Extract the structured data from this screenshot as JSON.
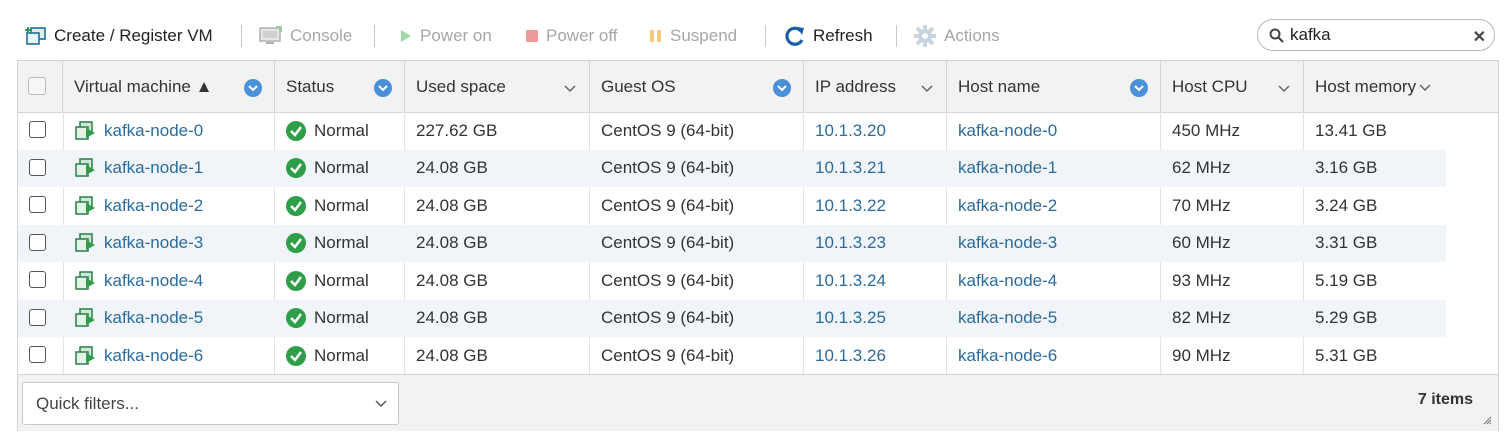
{
  "toolbar": {
    "create_label": "Create / Register VM",
    "console_label": "Console",
    "poweron_label": "Power on",
    "poweroff_label": "Power off",
    "suspend_label": "Suspend",
    "refresh_label": "Refresh",
    "actions_label": "Actions"
  },
  "search": {
    "value": "kafka"
  },
  "columns": {
    "vm": "Virtual machine ▲",
    "status": "Status",
    "used": "Used space",
    "os": "Guest OS",
    "ip": "IP address",
    "host": "Host name",
    "cpu": "Host CPU",
    "mem": "Host memory"
  },
  "rows": [
    {
      "name": "kafka-node-0",
      "status": "Normal",
      "used": "227.62 GB",
      "os": "CentOS 9 (64-bit)",
      "ip": "10.1.3.20",
      "host": "kafka-node-0",
      "cpu": "450 MHz",
      "mem": "13.41 GB"
    },
    {
      "name": "kafka-node-1",
      "status": "Normal",
      "used": "24.08 GB",
      "os": "CentOS 9 (64-bit)",
      "ip": "10.1.3.21",
      "host": "kafka-node-1",
      "cpu": "62 MHz",
      "mem": "3.16 GB"
    },
    {
      "name": "kafka-node-2",
      "status": "Normal",
      "used": "24.08 GB",
      "os": "CentOS 9 (64-bit)",
      "ip": "10.1.3.22",
      "host": "kafka-node-2",
      "cpu": "70 MHz",
      "mem": "3.24 GB"
    },
    {
      "name": "kafka-node-3",
      "status": "Normal",
      "used": "24.08 GB",
      "os": "CentOS 9 (64-bit)",
      "ip": "10.1.3.23",
      "host": "kafka-node-3",
      "cpu": "60 MHz",
      "mem": "3.31 GB"
    },
    {
      "name": "kafka-node-4",
      "status": "Normal",
      "used": "24.08 GB",
      "os": "CentOS 9 (64-bit)",
      "ip": "10.1.3.24",
      "host": "kafka-node-4",
      "cpu": "93 MHz",
      "mem": "5.19 GB"
    },
    {
      "name": "kafka-node-5",
      "status": "Normal",
      "used": "24.08 GB",
      "os": "CentOS 9 (64-bit)",
      "ip": "10.1.3.25",
      "host": "kafka-node-5",
      "cpu": "82 MHz",
      "mem": "5.29 GB"
    },
    {
      "name": "kafka-node-6",
      "status": "Normal",
      "used": "24.08 GB",
      "os": "CentOS 9 (64-bit)",
      "ip": "10.1.3.26",
      "host": "kafka-node-6",
      "cpu": "90 MHz",
      "mem": "5.31 GB"
    }
  ],
  "footer": {
    "quick_filters": "Quick filters...",
    "count": "7 items"
  },
  "icons": {
    "create": "create-vm-icon",
    "console": "console-icon",
    "poweron": "play-icon",
    "poweroff": "stop-icon",
    "suspend": "pause-icon",
    "refresh": "refresh-icon",
    "actions": "gear-icon",
    "vm": "vm-icon",
    "status": "check-circle-icon"
  },
  "colors": {
    "link": "#2b6b9d",
    "status_ok": "#2e9e48",
    "sort_badge": "#4a90d9",
    "row_alt": "#f1f5fa"
  }
}
